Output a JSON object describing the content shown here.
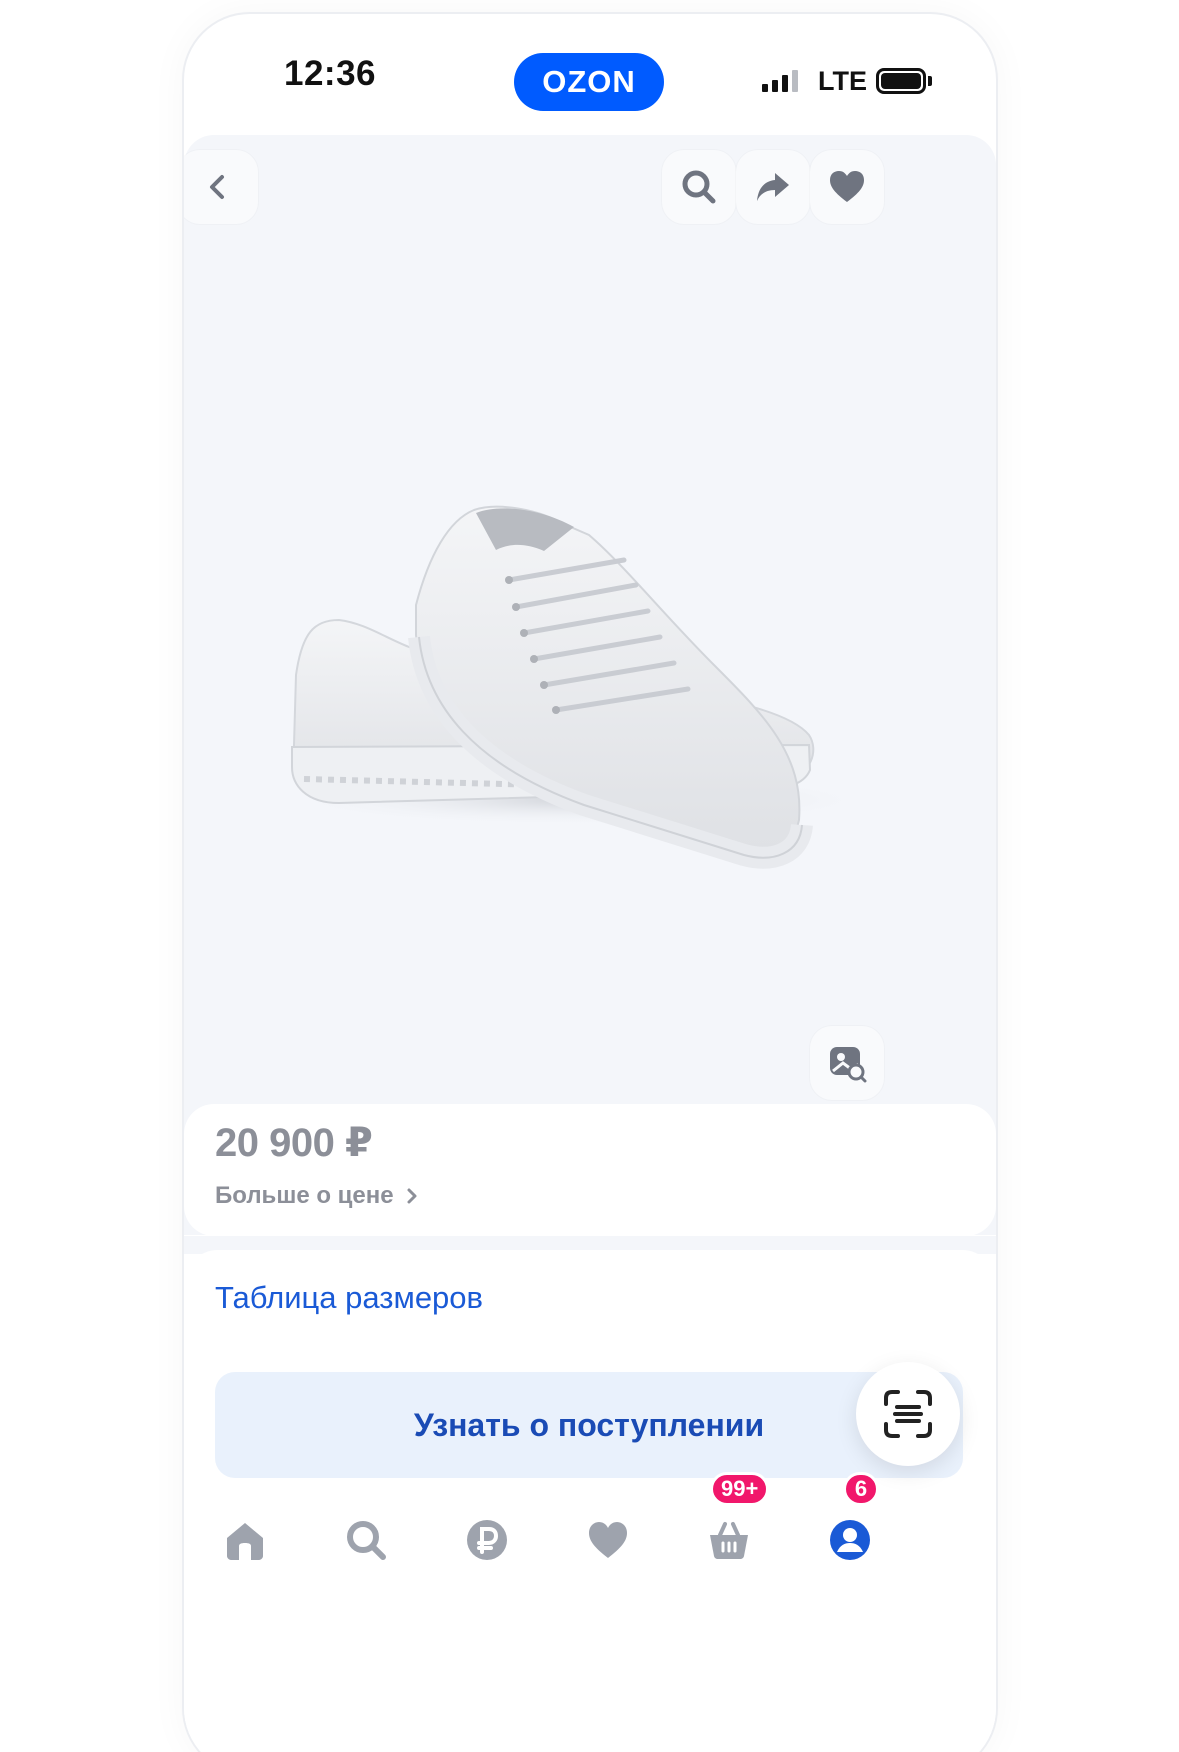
{
  "status_bar": {
    "time": "12:36",
    "brand": "OZON",
    "network": "LTE"
  },
  "product": {
    "image_description_icon": "sneaker-photo",
    "top_actions": [
      {
        "name": "back",
        "icon": "chevron-left-icon"
      },
      {
        "name": "search",
        "icon": "search-icon"
      },
      {
        "name": "share",
        "icon": "share-icon"
      },
      {
        "name": "favorite",
        "icon": "heart-icon"
      }
    ],
    "visual_search_icon": "image-search-icon"
  },
  "price": {
    "value": "20 900 ₽",
    "more_label": "Больше о цене"
  },
  "sizes": {
    "table_label": "Таблица размеров",
    "notify_button": "Узнать о поступлении"
  },
  "tabbar": {
    "items": [
      {
        "name": "home",
        "icon": "home-icon"
      },
      {
        "name": "catalog",
        "icon": "search-icon"
      },
      {
        "name": "finance",
        "icon": "ruble-icon"
      },
      {
        "name": "favorites",
        "icon": "heart-icon"
      },
      {
        "name": "cart",
        "icon": "basket-icon",
        "badge": "99+"
      },
      {
        "name": "profile",
        "icon": "profile-icon",
        "badge": "6"
      }
    ]
  },
  "colors": {
    "brand_blue": "#005bff",
    "link_blue": "#1a5ad6",
    "badge_pink": "#f1176b",
    "icon_grey": "#9ea3ad",
    "price_grey": "#8c8f98"
  }
}
